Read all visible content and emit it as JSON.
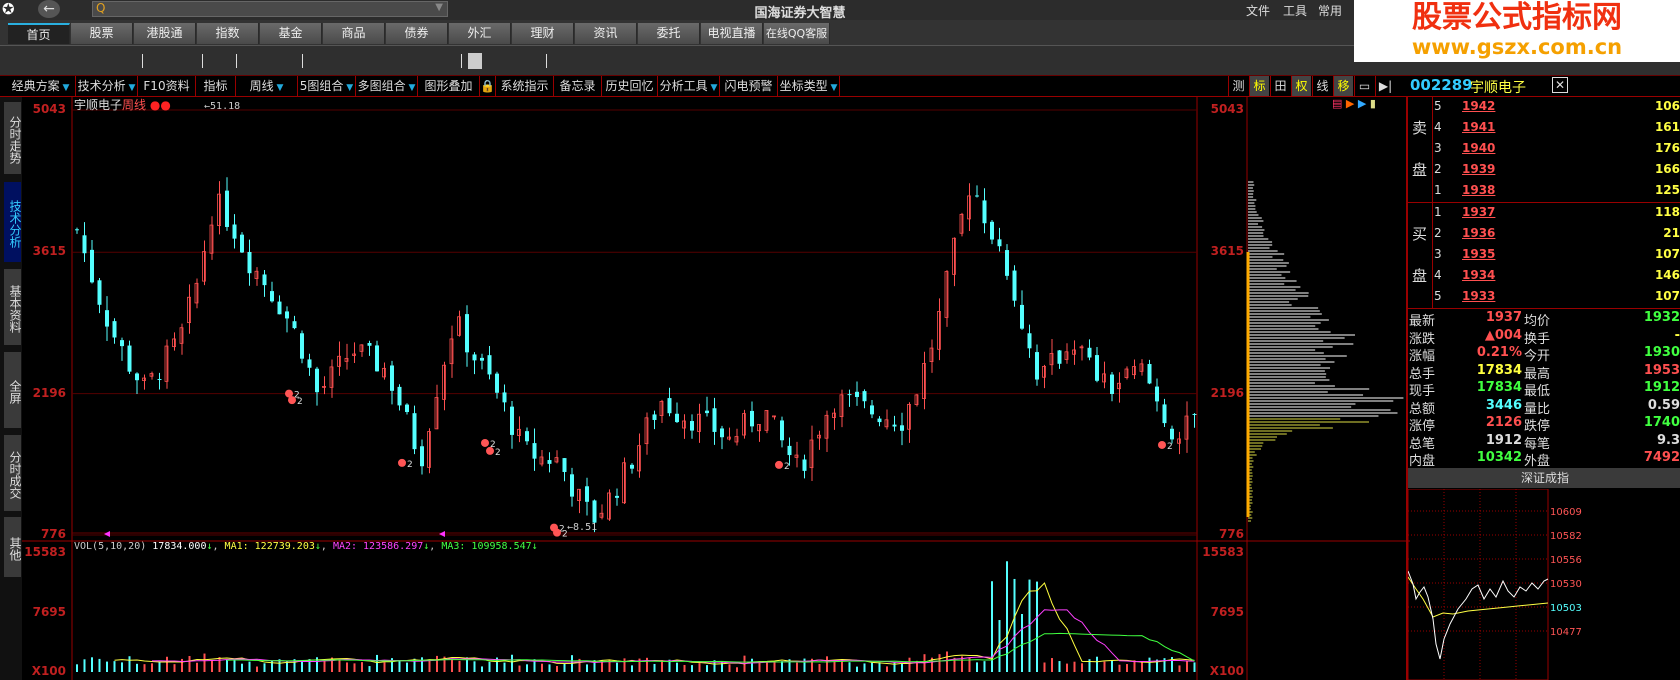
{
  "titlebar": {
    "title": "国海证券大智慧",
    "menus": [
      "文件",
      "工具",
      "常用"
    ],
    "search_placeholder": ""
  },
  "watermark": {
    "line1": "股票公式指标网",
    "line2": "www.gszx.com.cn"
  },
  "tabs": [
    "首页",
    "股票",
    "港股通",
    "指数",
    "基金",
    "商品",
    "债券",
    "外汇",
    "理财",
    "资讯",
    "委托",
    "电视直播",
    "在线QQ客服"
  ],
  "toolbar": [
    {
      "label": "经典方案",
      "dd": true
    },
    {
      "label": "技术分析",
      "dd": true
    },
    {
      "label": "F10资料",
      "dd": false
    },
    {
      "label": "指标",
      "dd": false
    },
    {
      "label": "周线",
      "dd": true
    },
    {
      "label": "5图组合",
      "dd": true
    },
    {
      "label": "多图组合",
      "dd": true
    },
    {
      "label": "图形叠加",
      "dd": false
    },
    {
      "label": "🔒",
      "dd": false
    },
    {
      "label": "系统指示",
      "dd": false
    },
    {
      "label": "备忘录",
      "dd": false
    },
    {
      "label": "历史回忆",
      "dd": false
    },
    {
      "label": "分析工具",
      "dd": true
    },
    {
      "label": "闪电预警",
      "dd": false
    },
    {
      "label": "坐标类型",
      "dd": true
    }
  ],
  "right_toolbar": [
    "测",
    "标",
    "田",
    "权",
    "线",
    "移",
    "▭",
    "▶|"
  ],
  "sidebar": [
    "分时走势",
    "技术分析",
    "基本资料",
    "全屏",
    "分时成交",
    "其他"
  ],
  "chart": {
    "stock_name": "宇顺电子",
    "period": "周线",
    "high_label": "51.18",
    "low_label": "8.51",
    "signal_label": "2",
    "price_ticks": [
      "5043",
      "3615",
      "2196",
      "776"
    ],
    "price_tick_values": [
      5043,
      3615,
      2196,
      776
    ],
    "price_range": [
      776,
      5043
    ],
    "vol_ticks": [
      "15583",
      "7695",
      "X100"
    ],
    "vol_max": 15583,
    "volume_legend": {
      "name": "VOL(5,10,20)",
      "value": "17834.000",
      "ma1": "MA1: 122739.203",
      "ma2": "MA2: 123586.297",
      "ma3": "MA3: 109958.547"
    },
    "close_path": [
      3838,
      3300,
      2834,
      2500,
      2232,
      2500,
      2733,
      3300,
      4140,
      3900,
      3537,
      3300,
      3035,
      2700,
      2182,
      2400,
      2633,
      2550,
      2432,
      2000,
      1529,
      2300,
      2934,
      2600,
      2332,
      2000,
      1630,
      1550,
      1529,
      1200,
      927,
      1150,
      1429,
      1800,
      2131,
      2000,
      1931,
      1850,
      1730,
      1900,
      2031,
      1700,
      1429,
      1800,
      2131,
      2100,
      2031,
      1980,
      1931,
      2300,
      2834,
      3600,
      4340,
      3900,
      3537,
      2900,
      2332,
      2550,
      2733,
      2450,
      2232,
      2350,
      2432,
      2050,
      1730,
      1931
    ],
    "signal_prices": [
      2196,
      2130,
      1500,
      1700,
      1620,
      850,
      800,
      1480,
      1680
    ],
    "colors": {
      "up": "#ff5050",
      "down": "#54ffff",
      "grid": "#900",
      "ma1": "#ffff40",
      "ma2": "#ff40ff",
      "ma3": "#40ff40"
    }
  },
  "quote": {
    "code": "002289",
    "name": "宇顺电子",
    "sell_label": [
      "卖",
      "盘"
    ],
    "buy_label": [
      "买",
      "盘"
    ],
    "sell": [
      {
        "lvl": "5",
        "price": "1942",
        "vol": "106"
      },
      {
        "lvl": "4",
        "price": "1941",
        "vol": "161"
      },
      {
        "lvl": "3",
        "price": "1940",
        "vol": "176"
      },
      {
        "lvl": "2",
        "price": "1939",
        "vol": "166"
      },
      {
        "lvl": "1",
        "price": "1938",
        "vol": "125"
      }
    ],
    "buy": [
      {
        "lvl": "1",
        "price": "1937",
        "vol": "118"
      },
      {
        "lvl": "2",
        "price": "1936",
        "vol": "21"
      },
      {
        "lvl": "3",
        "price": "1935",
        "vol": "107"
      },
      {
        "lvl": "4",
        "price": "1934",
        "vol": "146"
      },
      {
        "lvl": "5",
        "price": "1933",
        "vol": "107"
      }
    ],
    "stats": [
      {
        "k1": "最新",
        "v1": "1937",
        "c1": "#ff5050",
        "k2": "均价",
        "v2": "1932",
        "c2": "#40ff40"
      },
      {
        "k1": "涨跌",
        "v1": "▲004",
        "c1": "#ff5050",
        "k2": "换手",
        "v2": "-",
        "c2": "#ffff40"
      },
      {
        "k1": "涨幅",
        "v1": "0.21%",
        "c1": "#ff5050",
        "k2": "今开",
        "v2": "1930",
        "c2": "#40ff40"
      },
      {
        "k1": "总手",
        "v1": "17834",
        "c1": "#ffff40",
        "k2": "最高",
        "v2": "1953",
        "c2": "#ff5050"
      },
      {
        "k1": "现手",
        "v1": "17834",
        "c1": "#40ff40",
        "k2": "最低",
        "v2": "1912",
        "c2": "#40ff40"
      },
      {
        "k1": "总额",
        "v1": "3446",
        "c1": "#54ffff",
        "k2": "量比",
        "v2": "0.59",
        "c2": "#ddd"
      },
      {
        "k1": "涨停",
        "v1": "2126",
        "c1": "#ff5050",
        "k2": "跌停",
        "v2": "1740",
        "c2": "#40ff40"
      },
      {
        "k1": "总笔",
        "v1": "1912",
        "c1": "#ddd",
        "k2": "每笔",
        "v2": "9.3",
        "c2": "#ddd"
      },
      {
        "k1": "内盘",
        "v1": "10342",
        "c1": "#40ff40",
        "k2": "外盘",
        "v2": "7492",
        "c2": "#ff5050"
      }
    ],
    "index_name": "深证成指",
    "index_ticks": [
      "10609",
      "10582",
      "10556",
      "10530",
      "10503",
      "10477"
    ]
  }
}
